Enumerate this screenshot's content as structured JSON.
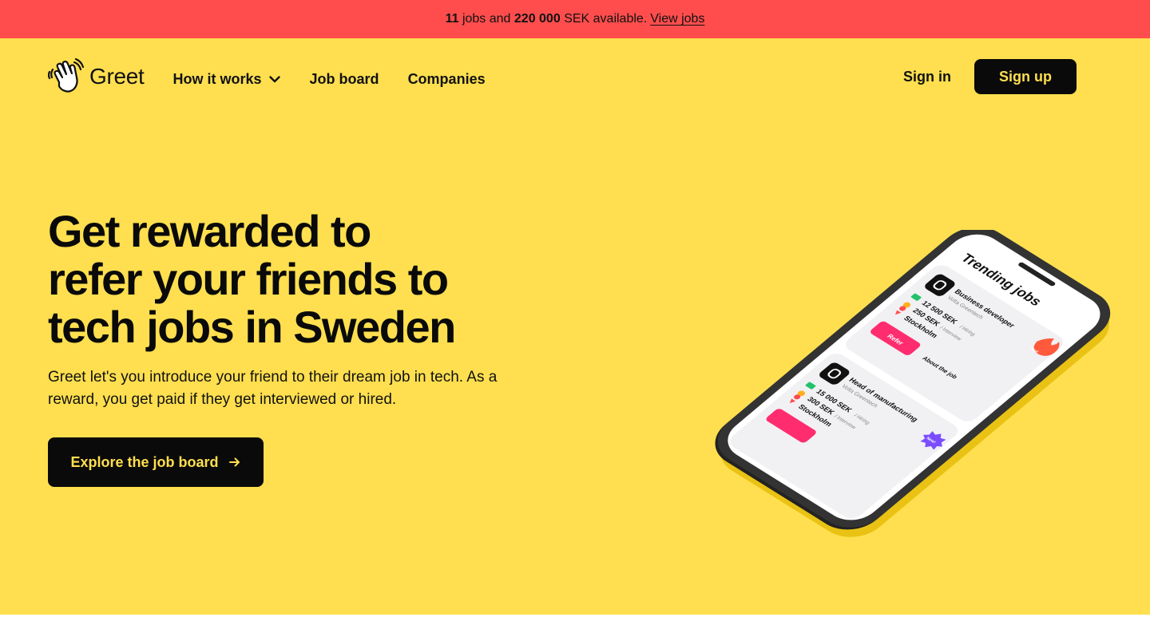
{
  "banner": {
    "jobs_count": "11",
    "jobs_text": "jobs and",
    "amount": "220 000",
    "amount_text": "SEK available.",
    "link_label": "View jobs"
  },
  "nav": {
    "logo_text": "Greet",
    "links": [
      "How it works",
      "Job board",
      "Companies"
    ],
    "sign_in": "Sign in",
    "sign_up": "Sign up"
  },
  "hero": {
    "headline_lines": [
      "Get rewarded to",
      "refer your friends to",
      "tech jobs in Sweden"
    ],
    "subtitle": "Greet let's you introduce your friend to their dream job in tech. As a reward, you get paid if they get interviewed or hired.",
    "cta_label": "Explore the job board"
  },
  "phone": {
    "title": "Trending jobs",
    "jobs": [
      {
        "role": "Business developer",
        "company": "Volta Greentech",
        "salary": "12 500 SEK",
        "salary_note": "/ Hiring",
        "reward": "250 SEK",
        "reward_note": "/ Interview",
        "location": "Stockholm",
        "badge": "Hot!",
        "refer_label": "Refer",
        "about_label": "About the job"
      },
      {
        "role": "Head of manufacturing",
        "company": "Volta Greentech",
        "salary": "15 000 SEK",
        "salary_note": "/ Hiring",
        "reward": "300 SEK",
        "reward_note": "/ Interview",
        "location": "Stockholm",
        "badge": "New!"
      }
    ]
  },
  "colors": {
    "banner_bg": "#ff4d4d",
    "hero_bg": "#ffdf4f",
    "primary_dark": "#0a0a0a",
    "refer_pink": "#ff2d6f",
    "hot_badge": "#ff5a3c",
    "new_badge": "#7b4dff"
  },
  "icons": [
    "wave-hand-icon",
    "chevron-down-icon",
    "arrow-right-icon",
    "money-icon",
    "coins-icon",
    "location-pin-icon"
  ]
}
